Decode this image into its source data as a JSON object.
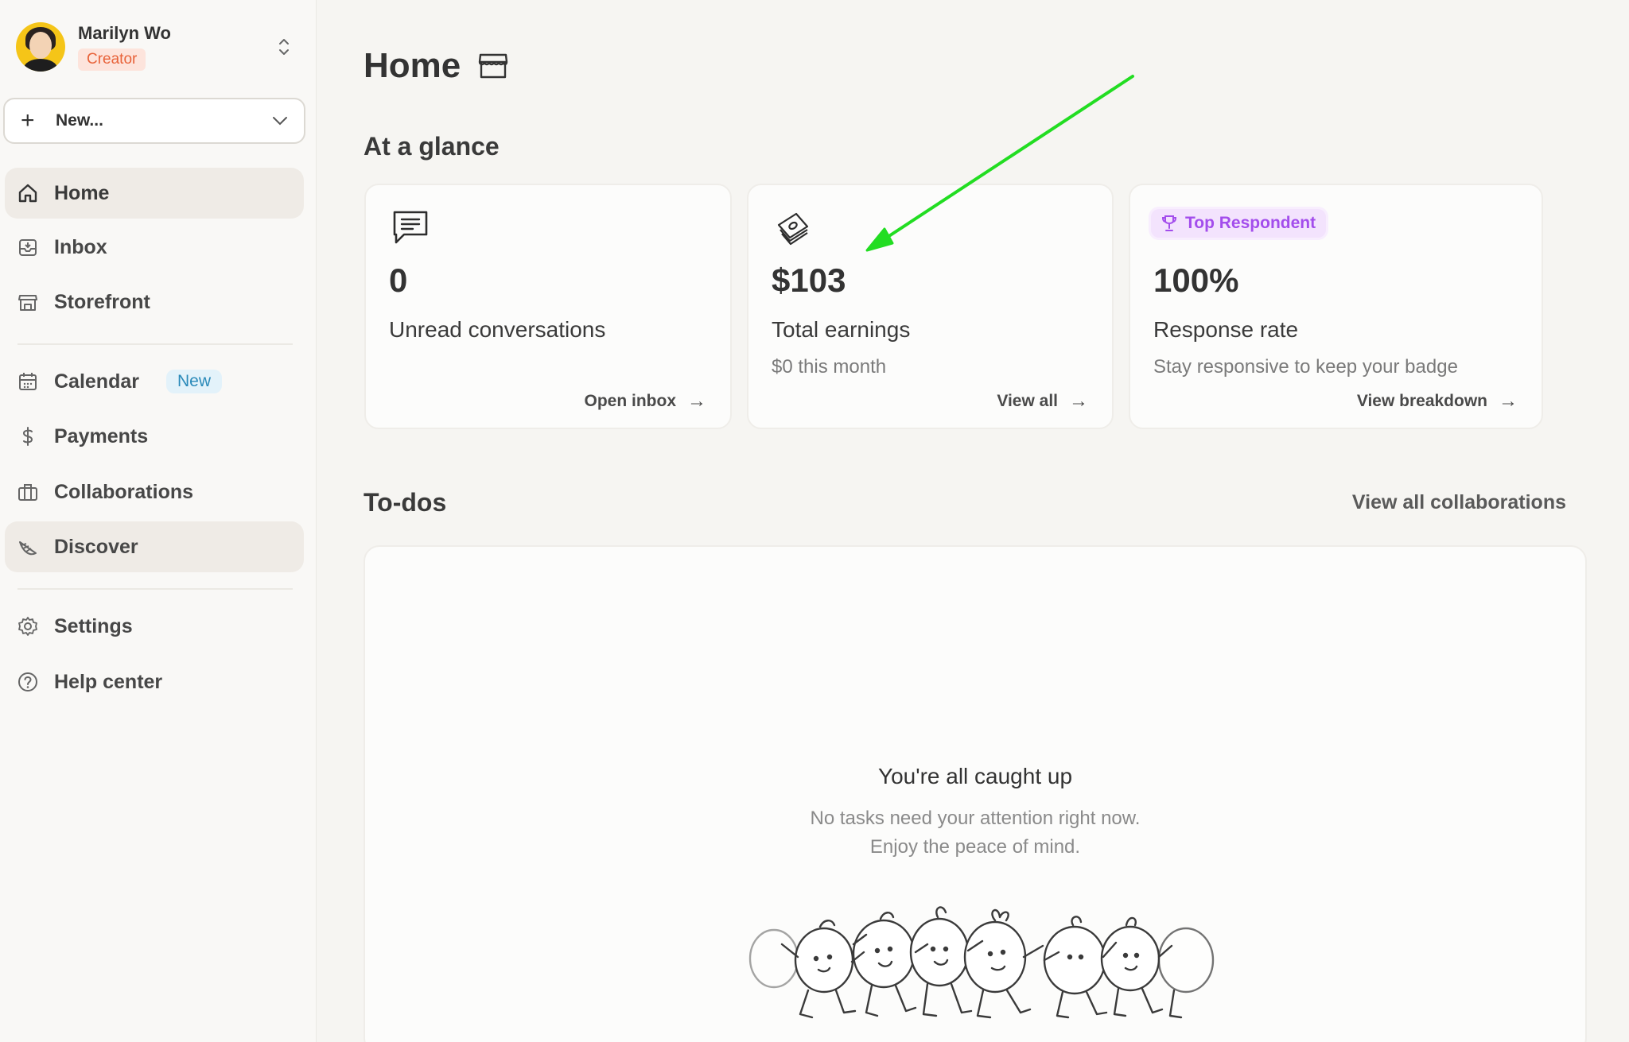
{
  "profile": {
    "name": "Marilyn Wo",
    "role": "Creator"
  },
  "new_button": {
    "label": "New..."
  },
  "sidebar": {
    "items": [
      {
        "label": "Home",
        "icon": "home-icon",
        "active": true
      },
      {
        "label": "Inbox",
        "icon": "inbox-icon",
        "active": false
      },
      {
        "label": "Storefront",
        "icon": "storefront-icon",
        "active": false
      },
      {
        "label": "Calendar",
        "icon": "calendar-icon",
        "active": false,
        "badge": "New"
      },
      {
        "label": "Payments",
        "icon": "dollar-icon",
        "active": false
      },
      {
        "label": "Collaborations",
        "icon": "briefcase-icon",
        "active": false
      },
      {
        "label": "Discover",
        "icon": "discover-icon",
        "active": true
      },
      {
        "label": "Settings",
        "icon": "gear-icon",
        "active": false
      },
      {
        "label": "Help center",
        "icon": "help-icon",
        "active": false
      }
    ]
  },
  "page": {
    "title": "Home"
  },
  "glance": {
    "title": "At a glance",
    "cards": [
      {
        "value": "0",
        "label": "Unread conversations",
        "sub": "",
        "link": "Open inbox"
      },
      {
        "value": "$103",
        "label": "Total earnings",
        "sub": "$0 this month",
        "link": "View all"
      },
      {
        "badge": "Top Respondent",
        "value": "100%",
        "label": "Response rate",
        "sub": "Stay responsive to keep your badge",
        "link": "View breakdown"
      }
    ]
  },
  "todos": {
    "title": "To-dos",
    "link": "View all collaborations",
    "empty_title": "You're all caught up",
    "empty_line1": "No tasks need your attention right now.",
    "empty_line2": "Enjoy the peace of mind."
  },
  "colors": {
    "background": "#f6f5f2",
    "creator_badge": "#e8633a",
    "new_badge": "#2b8ab9",
    "top_respondent": "#a34dec",
    "annotation_arrow": "#22dd22"
  }
}
